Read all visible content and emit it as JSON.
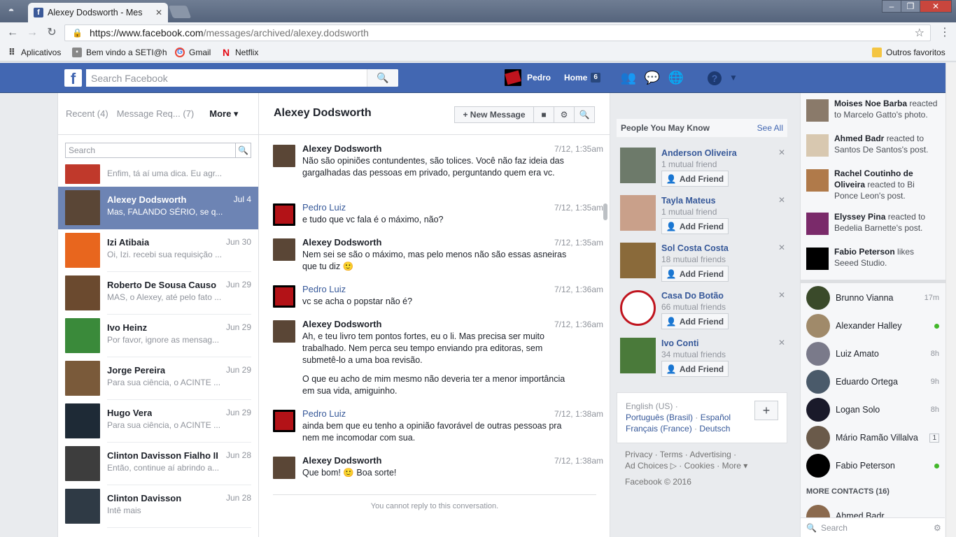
{
  "browser": {
    "tab_title": "Alexey Dodsworth - Mes",
    "url_host": "https://www.facebook.com",
    "url_path": "/messages/archived/alexey.dodsworth",
    "bookmarks": [
      {
        "label": "Aplicativos"
      },
      {
        "label": "Bem vindo a SETI@hc"
      },
      {
        "label": "Gmail"
      },
      {
        "label": "Netflix"
      }
    ],
    "other_bookmarks": "Outros favoritos"
  },
  "topbar": {
    "search_placeholder": "Search Facebook",
    "profile_name": "Pedro",
    "home_label": "Home",
    "home_count": "6",
    "help": "?"
  },
  "inbox": {
    "recent": "Recent (4)",
    "requests": "Message Req... (7)",
    "more": "More ▾",
    "search_placeholder": "Search",
    "partial_snippet": "Enfim, tá aí uma dica. Eu agr...",
    "threads": [
      {
        "name": "Alexey Dodsworth",
        "date": "Jul 4",
        "snippet": "Mas, FALANDO SÉRIO, se q...",
        "selected": true
      },
      {
        "name": "Izi Atibaia",
        "date": "Jun 30",
        "snippet": "Oi, Izi. recebi sua requisição ..."
      },
      {
        "name": "Roberto De Sousa Causo",
        "date": "Jun 29",
        "snippet": "MAS, o Alexey, até pelo fato ..."
      },
      {
        "name": "Ivo Heinz",
        "date": "Jun 29",
        "snippet": "Por favor, ignore as mensag..."
      },
      {
        "name": "Jorge Pereira",
        "date": "Jun 29",
        "snippet": "Para sua ciência, o ACINTE ..."
      },
      {
        "name": "Hugo Vera",
        "date": "Jun 29",
        "snippet": "Para sua ciência, o ACINTE ..."
      },
      {
        "name": "Clinton Davisson Fialho II",
        "date": "Jun 28",
        "snippet": "Então, continue aí abrindo a..."
      },
      {
        "name": "Clinton Davisson",
        "date": "Jun 28",
        "snippet": "Intê mais"
      }
    ]
  },
  "conversation": {
    "title": "Alexey Dodsworth",
    "new_message": "+ New Message",
    "messages": [
      {
        "sender": "Alexey Dodsworth",
        "time": "7/12, 1:35am",
        "text": "Não são opiniões contundentes, são tolices. Você não faz ideia das gargalhadas das pessoas em privado, perguntando quem era vc."
      },
      {
        "sender": "Pedro Luiz",
        "time": "7/12, 1:35am",
        "text": "e tudo que vc fala é o máximo, não?"
      },
      {
        "sender": "Alexey Dodsworth",
        "time": "7/12, 1:35am",
        "text": "Nem sei se são o máximo, mas pelo menos não são essas asneiras que tu diz 🙂"
      },
      {
        "sender": "Pedro Luiz",
        "time": "7/12, 1:36am",
        "text": "vc se acha o popstar não é?"
      },
      {
        "sender": "Alexey Dodsworth",
        "time": "7/12, 1:36am",
        "text": "Ah, e teu livro tem pontos fortes, eu o li. Mas precisa ser muito trabalhado. Nem perca seu tempo enviando pra editoras, sem submetê-lo a uma boa revisão.",
        "text2": "O que eu acho de mim mesmo não deveria ter a menor importância em sua vida, amiguinho."
      },
      {
        "sender": "Pedro Luiz",
        "time": "7/12, 1:38am",
        "text": "ainda bem que eu tenho a opinião favorável de outras pessoas pra nem me incomodar com sua."
      },
      {
        "sender": "Alexey Dodsworth",
        "time": "7/12, 1:38am",
        "text": "Que bom! 🙂 Boa sorte!"
      }
    ],
    "no_reply": "You cannot reply to this conversation."
  },
  "pymk": {
    "title": "People You May Know",
    "see_all": "See All",
    "add_label": "Add Friend",
    "people": [
      {
        "name": "Anderson Oliveira",
        "mutual": "1 mutual friend"
      },
      {
        "name": "Tayla Mateus",
        "mutual": "1 mutual friend"
      },
      {
        "name": "Sol Costa Costa",
        "mutual": "18 mutual friends"
      },
      {
        "name": "Casa Do Botão",
        "mutual": "66 mutual friends"
      },
      {
        "name": "Ivo Conti",
        "mutual": "34 mutual friends"
      }
    ]
  },
  "languages": {
    "current": "English (US) ·",
    "l1": "Português (Brasil)",
    "l2": "Español",
    "l3": "Français (France)",
    "l4": "Deutsch"
  },
  "footer": {
    "line1": "Privacy · Terms · Advertising ·",
    "line2": "Ad Choices ▷ · Cookies · More ▾",
    "copyright": "Facebook © 2016"
  },
  "ticker": [
    {
      "name": "Moises Noe Barba",
      "action": "reacted to Marcelo Gatto's photo."
    },
    {
      "name": "Ahmed Badr",
      "action": "reacted to Santos De Santos's post."
    },
    {
      "name": "Rachel Coutinho de Oliveira",
      "action": "reacted to Bi Ponce Leon's post."
    },
    {
      "name": "Elyssey Pina",
      "action": "reacted to Bedelia Barnette's post."
    },
    {
      "name": "Fabio Peterson",
      "action": "likes Seeed Studio."
    }
  ],
  "contacts": [
    {
      "name": "Brunno Vianna",
      "info": "17m"
    },
    {
      "name": "Alexander Halley",
      "info": "online"
    },
    {
      "name": "Luiz Amato",
      "info": "8h"
    },
    {
      "name": "Eduardo Ortega",
      "info": "9h"
    },
    {
      "name": "Logan Solo",
      "info": "8h"
    },
    {
      "name": "Mário Ramão Villalva",
      "info": "1"
    },
    {
      "name": "Fabio Peterson",
      "info": "online"
    }
  ],
  "more_contacts": "MORE CONTACTS (16)",
  "more_contact_partial": "Ahmed Badr",
  "chat_search_placeholder": "Search",
  "colors": {
    "brand": "#4267b2",
    "selected_thread": "#6d84b4",
    "online": "#42b72a"
  }
}
